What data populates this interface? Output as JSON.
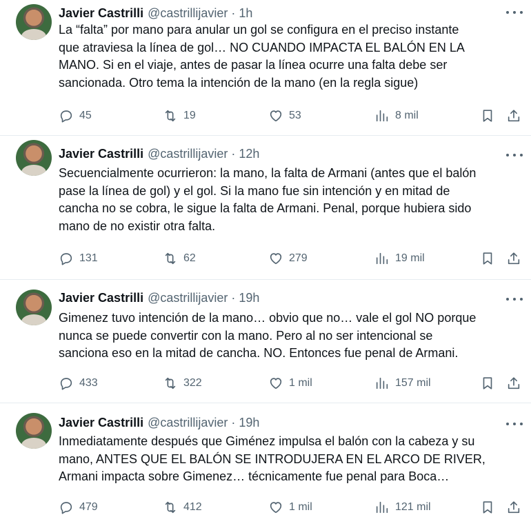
{
  "tweets": [
    {
      "name": "Javier Castrilli",
      "handle": "@castrillijavier",
      "separator": "·",
      "time": "1h",
      "text": "La “falta” por mano para anular un gol se configura en el preciso instante\nque atraviesa la línea de gol… NO CUANDO IMPACTA EL BALÓN EN LA\nMANO. Si en el viaje, antes de pasar la línea ocurre una falta debe ser\nsancionada. Otro tema la intención de la mano (en la regla sigue)",
      "replies": "45",
      "retweets": "19",
      "likes": "53",
      "views": "8 mil"
    },
    {
      "name": "Javier Castrilli",
      "handle": "@castrillijavier",
      "separator": "·",
      "time": "12h",
      "text": "Secuencialmente ocurrieron: la mano, la falta de Armani (antes que el balón\npase la línea de gol) y el gol. Si la mano fue sin intención y en mitad de\ncancha no se cobra, le sigue la falta de Armani. Penal, porque hubiera sido\nmano de no existir otra falta.",
      "replies": "131",
      "retweets": "62",
      "likes": "279",
      "views": "19 mil"
    },
    {
      "name": "Javier Castrilli",
      "handle": "@castrillijavier",
      "separator": "·",
      "time": "19h",
      "text": "Gimenez tuvo intención de la mano… obvio que no… vale el gol NO porque\nnunca se puede convertir con la mano. Pero al no ser intencional se\nsanciona eso en la mitad de cancha. NO. Entonces fue penal de Armani.",
      "replies": "433",
      "retweets": "322",
      "likes": "1 mil",
      "views": "157 mil"
    },
    {
      "name": "Javier Castrilli",
      "handle": "@castrillijavier",
      "separator": "·",
      "time": "19h",
      "text": "Inmediatamente después que Giménez impulsa el balón con la cabeza y su\nmano, ANTES QUE EL BALÓN SE INTRODUJERA EN EL ARCO DE RIVER,\nArmani impacta sobre Gimenez… técnicamente fue penal para Boca…",
      "replies": "479",
      "retweets": "412",
      "likes": "1 mil",
      "views": "121 mil"
    }
  ],
  "icons": {
    "reply": "reply-icon",
    "retweet": "retweet-icon",
    "like": "heart-icon",
    "views": "views-icon",
    "bookmark": "bookmark-icon",
    "share": "share-icon",
    "more": "more-icon"
  },
  "colors": {
    "text": "#0f1419",
    "muted": "#536471",
    "divider": "#e6ecf0"
  }
}
